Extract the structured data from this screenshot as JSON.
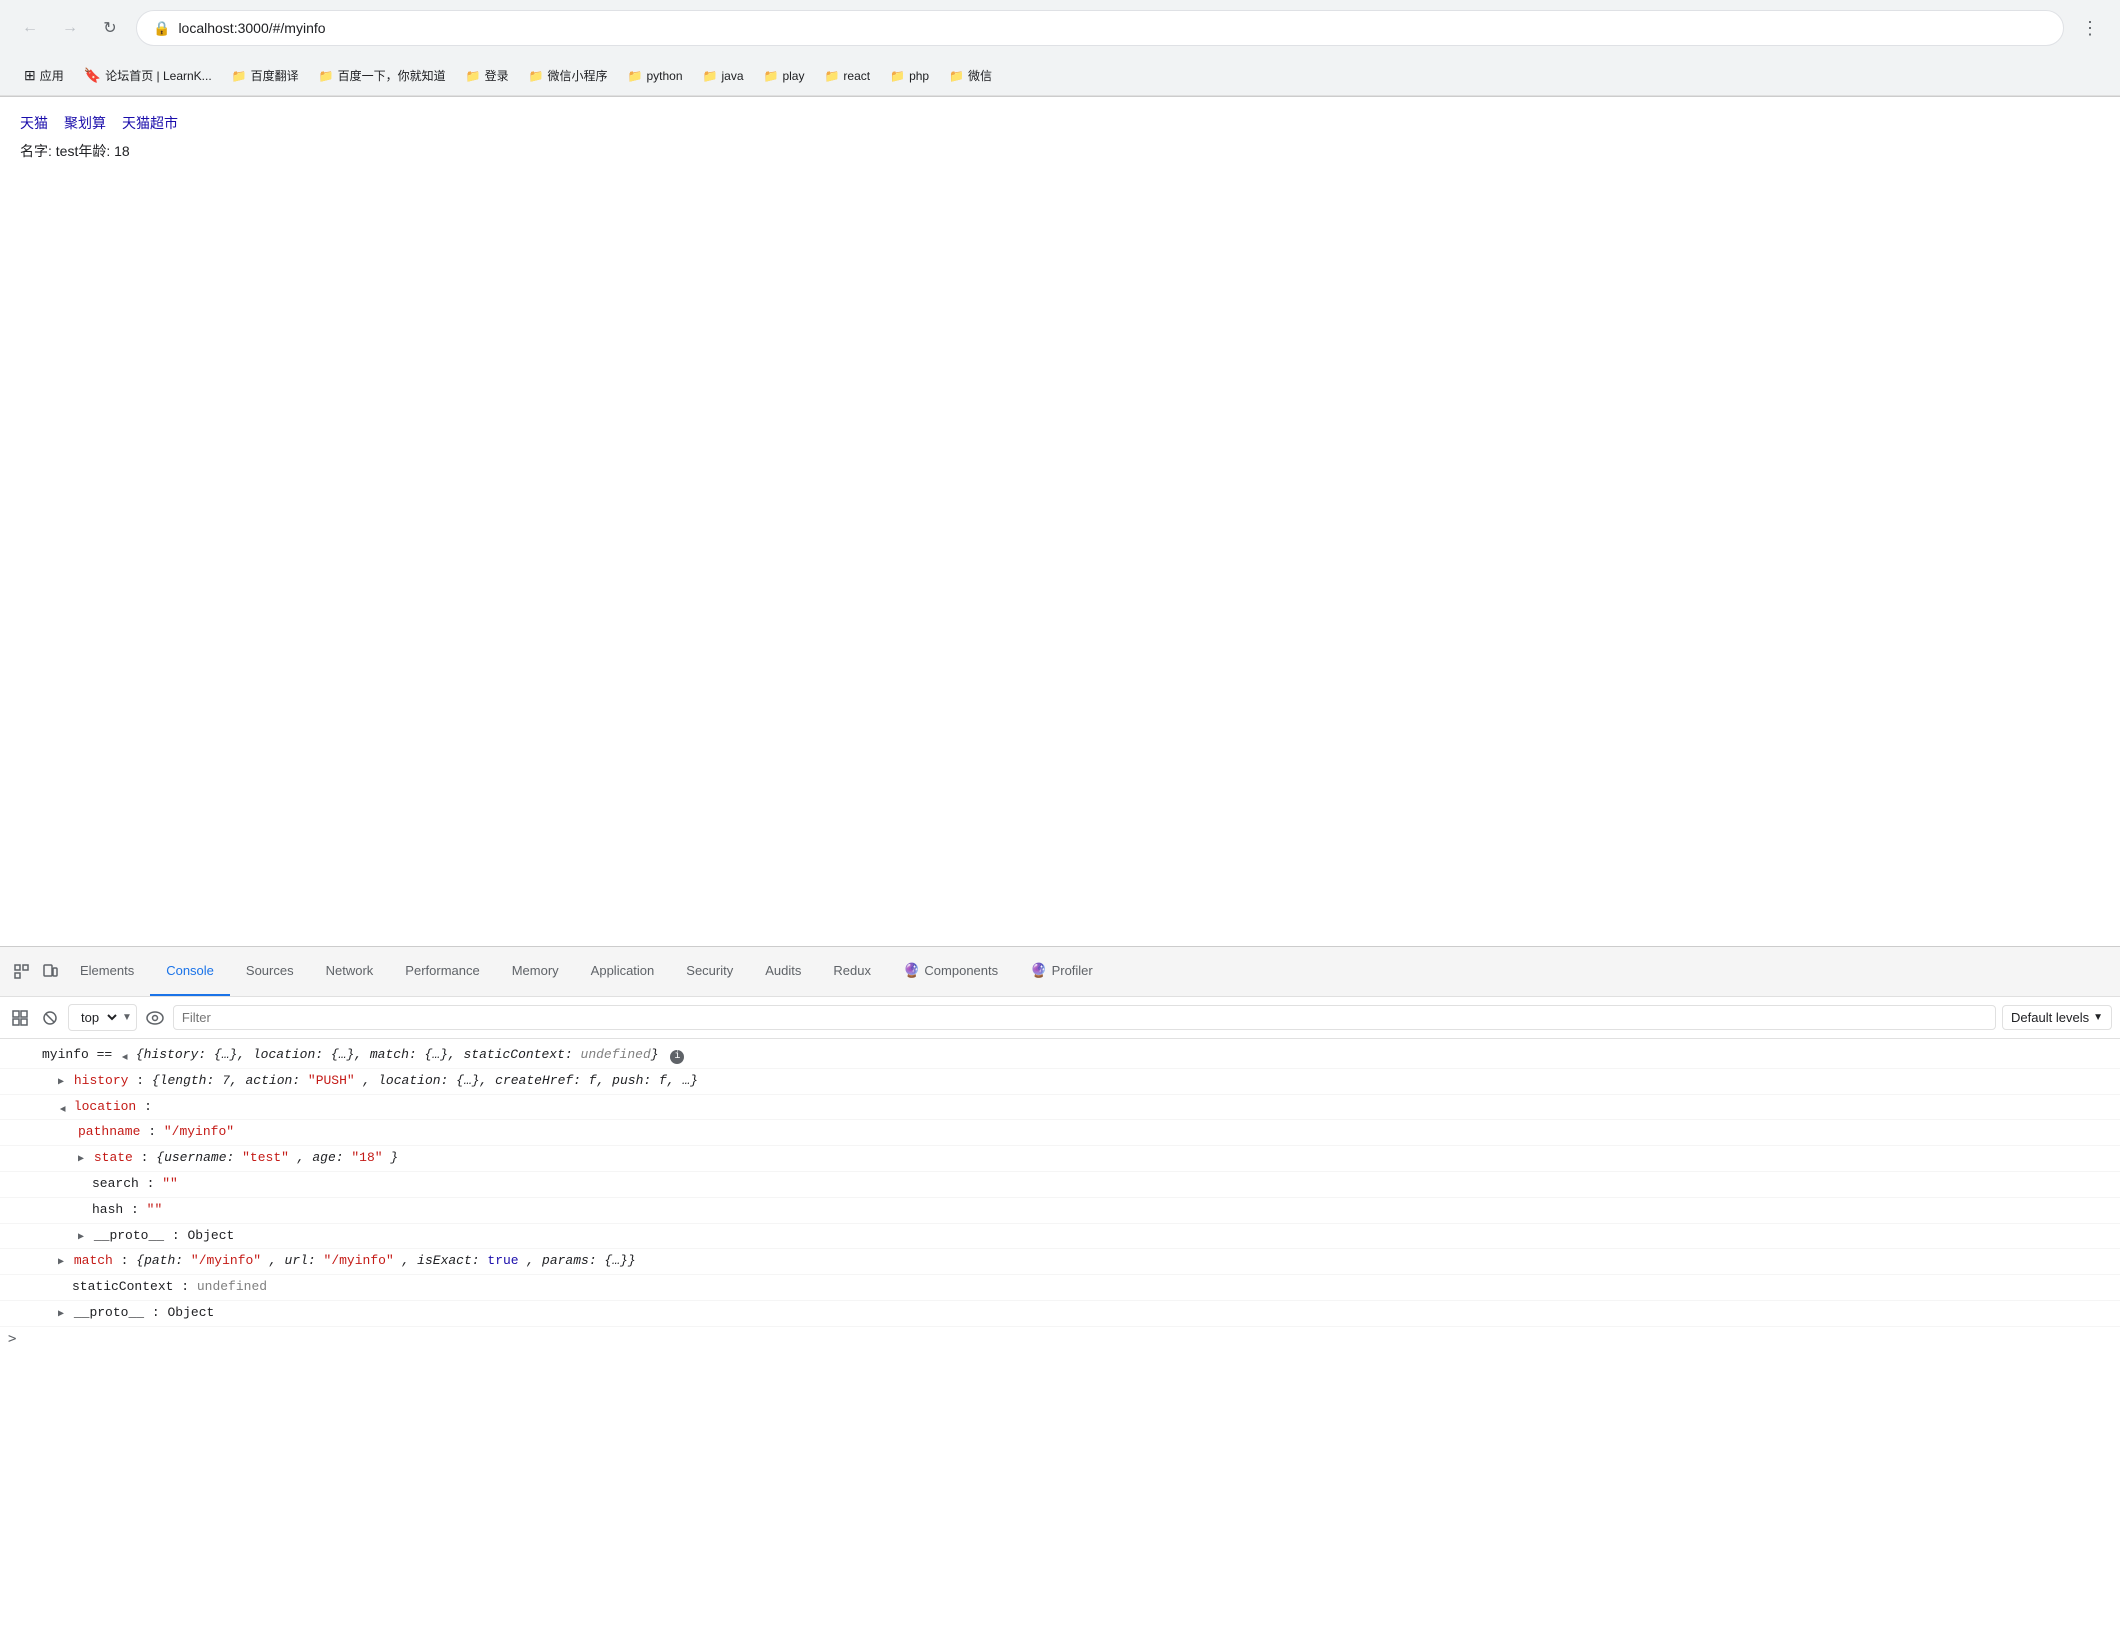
{
  "browser": {
    "url": "localhost:3000/#/myinfo",
    "nav": {
      "back_label": "←",
      "forward_label": "→",
      "reload_label": "↻",
      "menu_label": "⋮"
    }
  },
  "bookmarks": {
    "apps_label": "应用",
    "items": [
      {
        "label": "论坛首页 | LearnK...",
        "type": "link"
      },
      {
        "label": "百度翻译",
        "type": "folder"
      },
      {
        "label": "百度一下，你就知道",
        "type": "folder"
      },
      {
        "label": "登录",
        "type": "folder"
      },
      {
        "label": "微信小程序",
        "type": "folder"
      },
      {
        "label": "python",
        "type": "folder"
      },
      {
        "label": "java",
        "type": "folder"
      },
      {
        "label": "play",
        "type": "folder"
      },
      {
        "label": "react",
        "type": "folder"
      },
      {
        "label": "php",
        "type": "folder"
      },
      {
        "label": "微信",
        "type": "folder"
      }
    ]
  },
  "page": {
    "links": [
      "天猫",
      "聚划算",
      "天猫超市"
    ],
    "content": "名字: test年龄: 18"
  },
  "devtools": {
    "tabs": [
      {
        "label": "Elements",
        "active": false
      },
      {
        "label": "Console",
        "active": true
      },
      {
        "label": "Sources",
        "active": false
      },
      {
        "label": "Network",
        "active": false
      },
      {
        "label": "Performance",
        "active": false
      },
      {
        "label": "Memory",
        "active": false
      },
      {
        "label": "Application",
        "active": false
      },
      {
        "label": "Security",
        "active": false
      },
      {
        "label": "Audits",
        "active": false
      },
      {
        "label": "Redux",
        "active": false
      },
      {
        "label": "Components",
        "active": false,
        "icon": "🔮"
      },
      {
        "label": "Profiler",
        "active": false,
        "icon": "🔮"
      }
    ],
    "console": {
      "context": "top",
      "filter_placeholder": "Filter",
      "levels_label": "Default levels",
      "output": {
        "main_line": "myinfo == ▼ {history: {…}, location: {…}, match: {…}, staticContext: undefined}",
        "info_icon": "ℹ",
        "history_line": "▶ history: {length: 7, action: \"PUSH\", location: {…}, createHref: f, push: f, …}",
        "location_label": "▼ location:",
        "pathname_label": "pathname:",
        "pathname_value": "\"/myinfo\"",
        "state_label": "▶ state:",
        "state_value": "{username: \"test\", age: \"18\"}",
        "search_label": "search:",
        "search_value": "\"\"",
        "hash_label": "hash:",
        "hash_value": "\"\"",
        "proto1_label": "▶ __proto__:",
        "proto1_value": "Object",
        "match_label": "▶ match:",
        "match_value": "{path: \"/myinfo\", url: \"/myinfo\", isExact: true, params: {…}}",
        "static_label": "staticContext:",
        "static_value": "undefined",
        "proto2_label": "▶ __proto__:",
        "proto2_value": "Object"
      }
    }
  }
}
